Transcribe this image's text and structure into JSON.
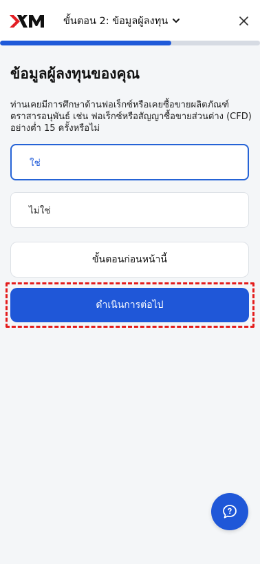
{
  "header": {
    "logo_text": "XM",
    "step_title": "ขั้นตอน 2: ข้อมูลผู้ลงทุน",
    "chevron_icon": "chevron-down-icon",
    "close_icon": "close-icon"
  },
  "progress": {
    "fraction": 0.66
  },
  "main": {
    "heading": "ข้อมูลผู้ลงทุนของคุณ",
    "question": "ท่านเคยมีการศึกษาด้านฟอเร็กซ์หรือเคยซื้อขายผลิตภัณฑ์ตราสารอนุพันธ์ เช่น ฟอเร็กซ์หรือสัญญาซื้อขายส่วนต่าง (CFD) อย่างต่ำ 15 ครั้งหรือไม่",
    "options": [
      {
        "label": "ใช่",
        "selected": true
      },
      {
        "label": "ไม่ใช่",
        "selected": false
      }
    ],
    "back_label": "ขั้นตอนก่อนหน้านี้",
    "continue_label": "ดำเนินการต่อไป"
  },
  "chat": {
    "icon": "chat-help-icon"
  },
  "colors": {
    "accent": "#1f57d8",
    "highlight": "#e41c1c",
    "background": "#f4f6f8"
  }
}
